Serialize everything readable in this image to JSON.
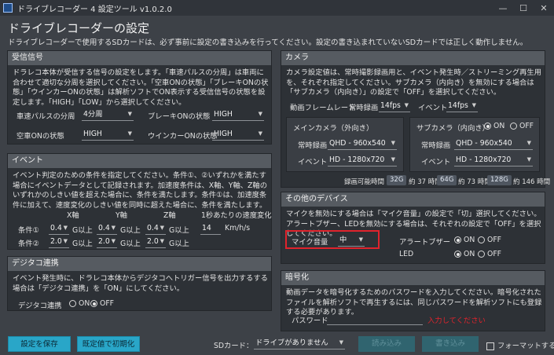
{
  "window": {
    "title": "ドライブレコーダー 4 設定ツール v1.0.2.0",
    "minimize": "—",
    "maximize": "☐",
    "close": "✕"
  },
  "header": {
    "title": "ドライブレコーダーの設定",
    "subtitle": "ドライブレコーダーで使用するSDカードは、必ず事前に設定の書き込みを行ってください。設定の書き込まれていないSDカードでは正しく動作しません。"
  },
  "signal": {
    "title": "受信信号",
    "desc": "ドラレコ本体が受信する信号の設定をします。「車速パルスの分周」は車両に合わせて適切な分周を選択してください。「空車ONの状態」「ブレーキONの状態」「ウインカーONの状態」は解析ソフトでON表示する受信信号の状態を設定します。「HIGH」「LOW」から選択してください。",
    "pulse_label": "車速パルスの分周",
    "pulse_value": "4分周",
    "brake_label": "ブレーキONの状態",
    "brake_value": "HIGH",
    "vacant_label": "空車ONの状態",
    "vacant_value": "HIGH",
    "winker_label": "ウインカーONの状態",
    "winker_value": "HIGH"
  },
  "event": {
    "title": "イベント",
    "desc": "イベント判定のための条件を指定してください。条件①、②いずれかを満たす場合にイベントデータとして記録されます。加速度条件は、X軸、Y軸、Z軸のいずれかのしきい値を超えた場合に、条件を満たします。条件①は、加速度条件に加えて、速度変化のしきい値を同時に超えた場合に、条件を満たします。",
    "col_x": "X軸",
    "col_y": "Y軸",
    "col_z": "Z軸",
    "col_speed": "1秒あたりの速度変化",
    "cond1_label": "条件①",
    "cond2_label": "条件②",
    "cond1_x": "0.4",
    "cond1_y": "0.4",
    "cond1_z": "0.4",
    "cond2_x": "2.0",
    "cond2_y": "2.0",
    "cond2_z": "2.0",
    "g_suffix": "G以上",
    "speed_value": "14",
    "speed_unit": "Km/h/s"
  },
  "digitacho": {
    "title": "デジタコ連携",
    "desc": "イベント発生時に、ドラレコ本体からデジタコへトリガー信号を出力するする場合は「デジタコ連携」を「ON」にしてください。",
    "label": "デジタコ連携",
    "on": "ON",
    "off": "OFF",
    "selected": "OFF"
  },
  "camera": {
    "title": "カメラ",
    "desc": "カメラ設定値は、常時撮影録画用と、イベント発生時／ストリーミング再生用を、それぞれ指定してください。サブカメラ（内向き）を無効にする場合は「サブカメラ（内向き）」の設定で「OFF」を選択してください。",
    "framerate_label": "動画フレームレート",
    "continuous_label": "常時録画",
    "continuous_fps": "14fps",
    "event_label": "イベント",
    "event_fps": "14fps",
    "main_title": "メインカメラ（外向き）",
    "main_continuous_label": "常時録画",
    "main_continuous_value": "QHD - 960x540",
    "main_event_label": "イベント",
    "main_event_value": "HD - 1280x720",
    "sub_title": "サブカメラ（内向き）",
    "sub_on": "ON",
    "sub_off": "OFF",
    "sub_selected": "ON",
    "sub_continuous_label": "常時録画",
    "sub_continuous_value": "QHD - 960x540",
    "sub_event_label": "イベント",
    "sub_event_value": "HD - 1280x720",
    "recordable_label": "録画可能時間",
    "cap1": "32G",
    "cap1_time": "約 37 時間",
    "cap2": "64G",
    "cap2_time": "約 73 時間",
    "cap3": "128G",
    "cap3_time": "約 146 時間"
  },
  "devices": {
    "title": "その他のデバイス",
    "desc": "マイクを無効にする場合は「マイク音量」の設定で「切」選択してください。アラートブザー、LEDを無効にする場合は、それぞれの設定で「OFF」を選択してください。",
    "mic_label": "マイク音量",
    "mic_value": "中",
    "buzzer_label": "アラートブザー",
    "buzzer_on": "ON",
    "buzzer_off": "OFF",
    "buzzer_selected": "ON",
    "led_label": "LED",
    "led_on": "ON",
    "led_off": "OFF",
    "led_selected": "ON"
  },
  "encryption": {
    "title": "暗号化",
    "desc": "動画データを暗号化するためのパスワードを入力してください。暗号化されたファイルを解析ソフトで再生するには、同じパスワードを解析ソフトにも登録する必要があります。",
    "password_label": "パスワード",
    "password_value": "",
    "error": "入力してください"
  },
  "footer": {
    "save_label": "設定を保存",
    "reset_label": "既定値で初期化",
    "sd_label": "SDカード：",
    "sd_value": "ドライブがありません",
    "read_label": "読み込み",
    "write_label": "書き込み",
    "format_label": "フォーマットする"
  },
  "colors": {
    "accent": "#29a6c8",
    "highlight": "#e0232c",
    "error": "#e0232c"
  }
}
